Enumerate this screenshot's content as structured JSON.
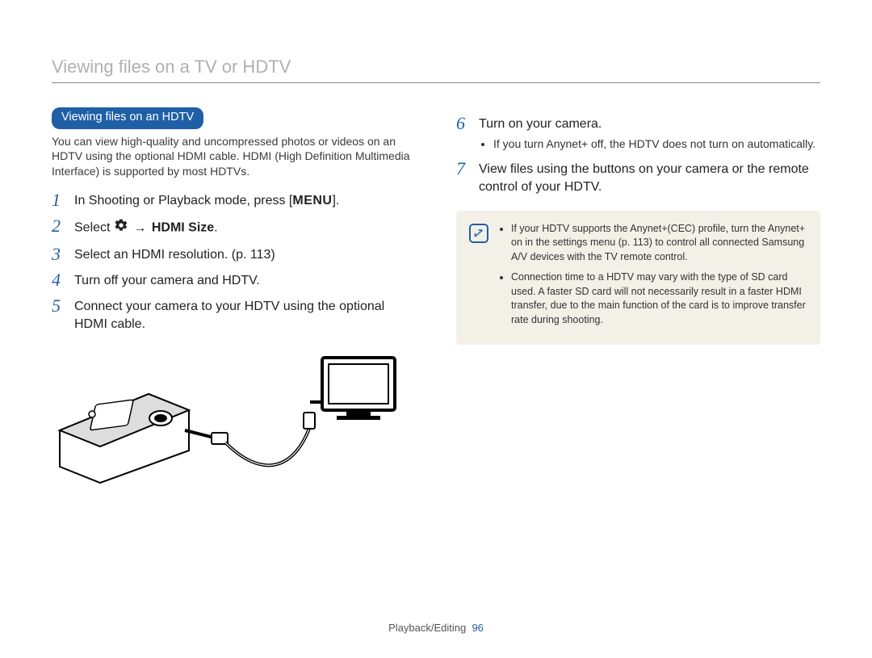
{
  "header": "Viewing files on a TV or HDTV",
  "left": {
    "section_pill": "Viewing files on an HDTV",
    "intro": "You can view high-quality and uncompressed photos or videos on an HDTV using the optional HDMI cable. HDMI (High Definition Multimedia Interface) is supported by most HDTVs.",
    "steps": {
      "s1": {
        "num": "1",
        "pre": "In Shooting or Playback mode, press [",
        "menu": "MENU",
        "post": "]."
      },
      "s2": {
        "num": "2",
        "select": "Select ",
        "arrow": "→",
        "hdmi": "HDMI Size",
        "end": "."
      },
      "s3": {
        "num": "3",
        "text": "Select an HDMI resolution. (p. 113)"
      },
      "s4": {
        "num": "4",
        "text": "Turn off your camera and HDTV."
      },
      "s5": {
        "num": "5",
        "text": "Connect your camera to your HDTV using the optional HDMI cable."
      }
    }
  },
  "right": {
    "steps": {
      "s6": {
        "num": "6",
        "text": "Turn on your camera.",
        "bullets": [
          "If you turn Anynet+ off, the HDTV does not turn on automatically."
        ]
      },
      "s7": {
        "num": "7",
        "text": "View files using the buttons on your camera or the remote control of your HDTV."
      }
    },
    "note_bullets": [
      "If your HDTV supports the Anynet+(CEC) profile, turn the Anynet+ on in the settings menu (p. 113) to control all connected Samsung A/V devices with the TV remote control.",
      "Connection time to a HDTV may vary with the type of SD card used. A faster SD card will not necessarily result in a faster HDMI transfer, due to the main function of the card is to improve transfer rate during shooting."
    ]
  },
  "footer": {
    "section": "Playback/Editing",
    "page": "96"
  }
}
